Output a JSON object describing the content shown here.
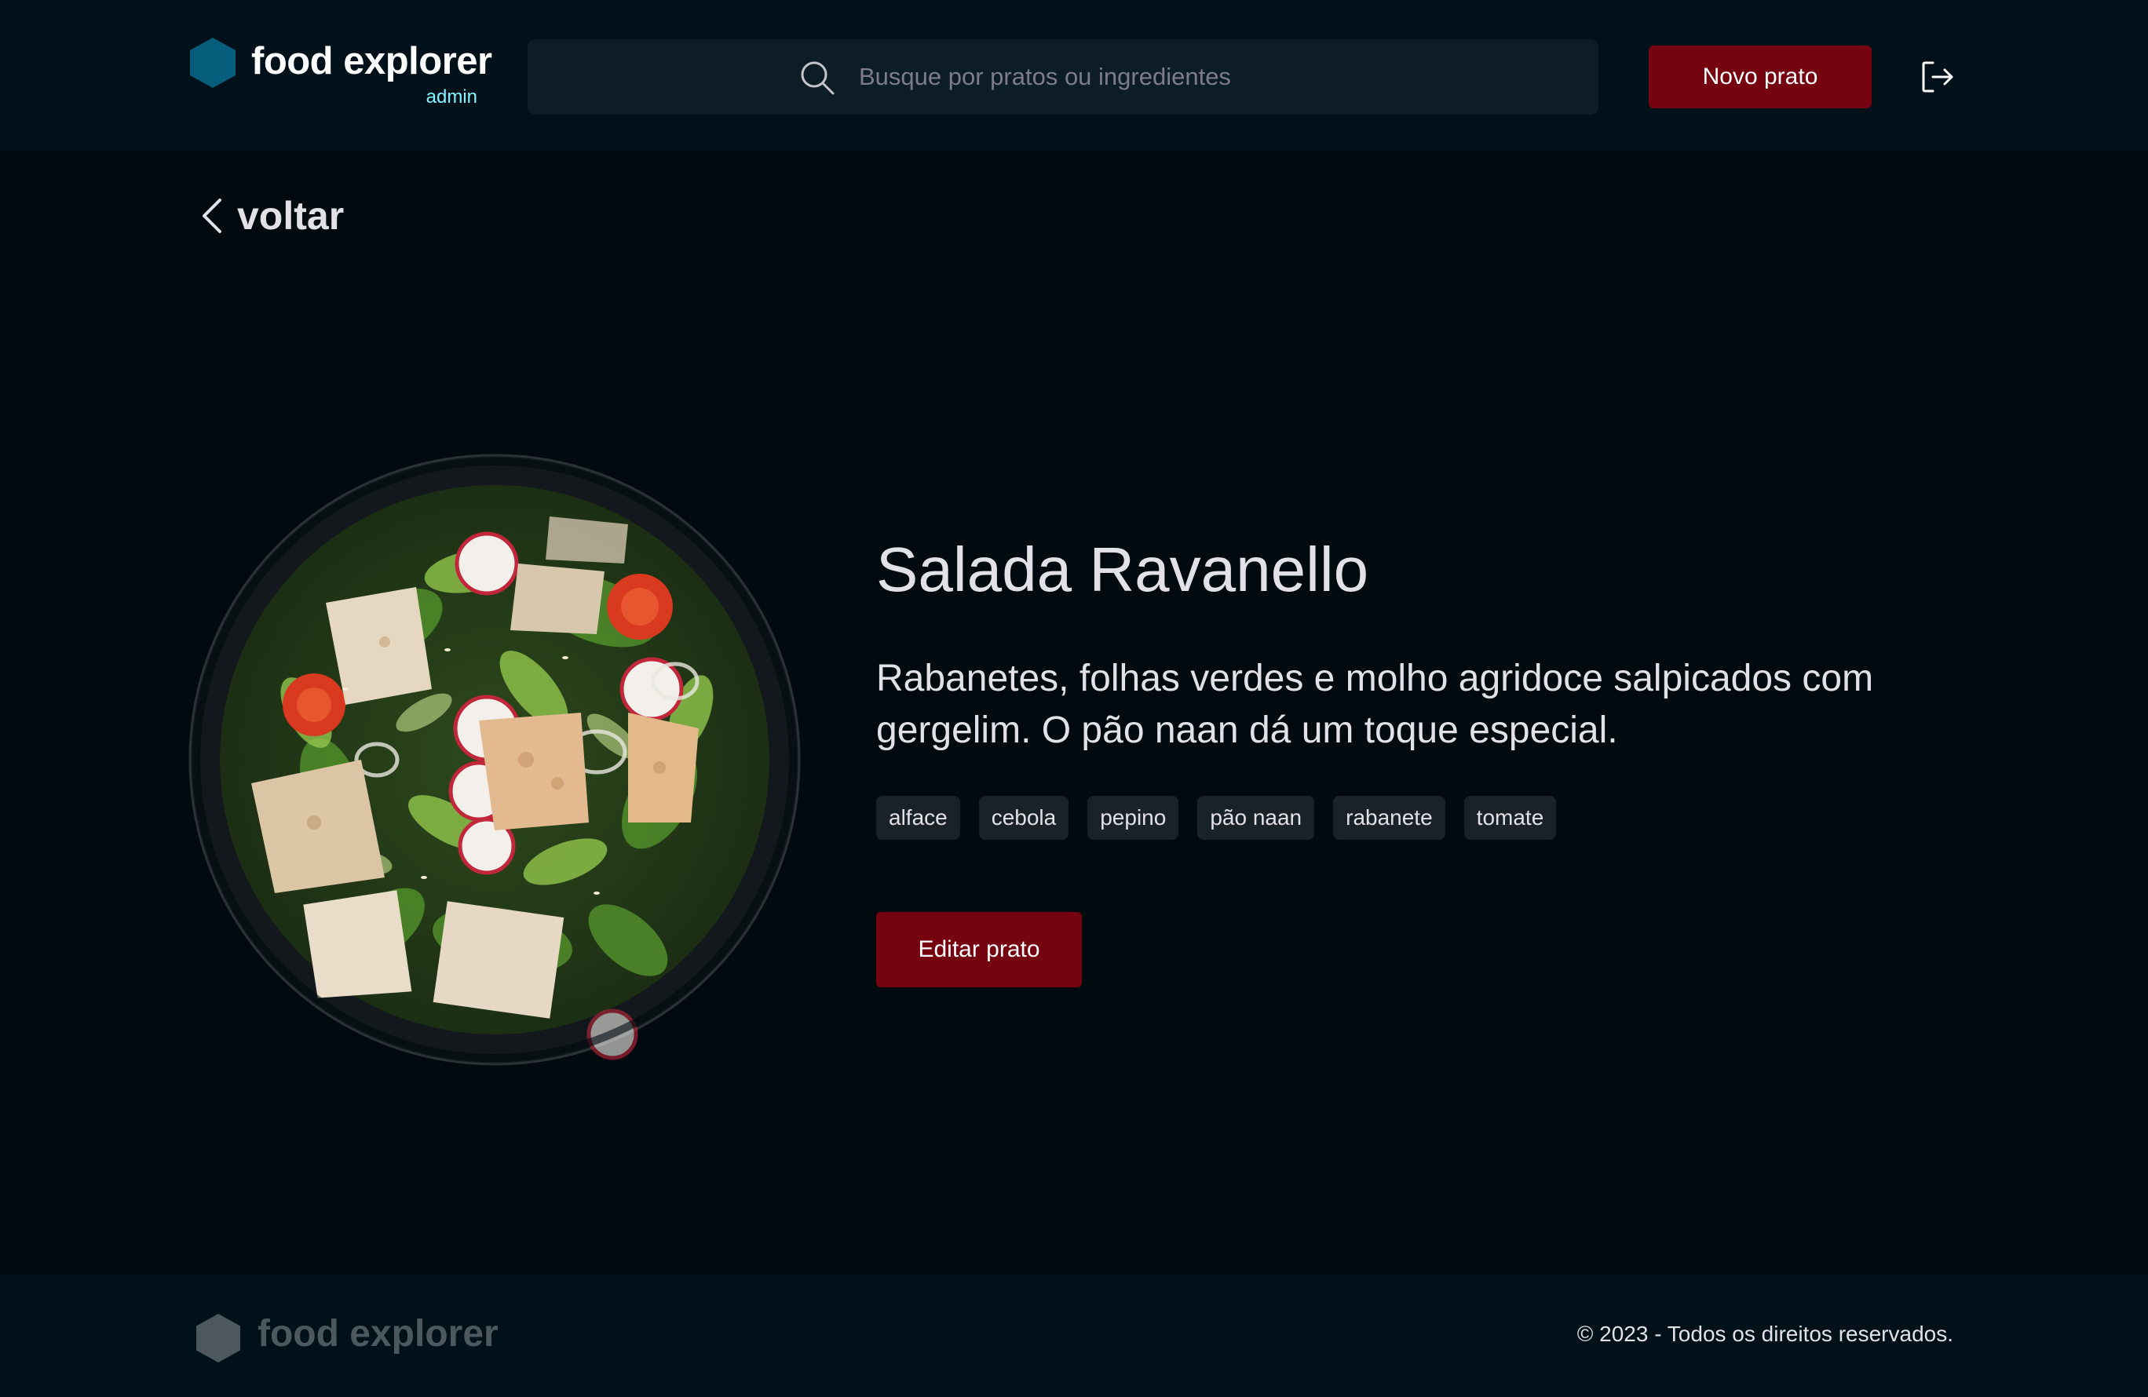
{
  "header": {
    "brand_name": "food explorer",
    "brand_role": "admin",
    "search_placeholder": "Busque por pratos ou ingredientes",
    "new_dish_label": "Novo prato"
  },
  "back_label": "voltar",
  "dish": {
    "name": "Salada Ravanello",
    "description": "Rabanetes, folhas verdes e molho agridoce salpicados com gergelim. O pão naan dá um toque especial.",
    "ingredients": [
      "alface",
      "cebola",
      "pepino",
      "pão naan",
      "rabanete",
      "tomate"
    ],
    "edit_label": "Editar prato"
  },
  "footer": {
    "brand_name": "food explorer",
    "copyright": "© 2023 - Todos os direitos reservados."
  },
  "colors": {
    "background": "#000a0f",
    "header_bg": "#00111a",
    "accent_red": "#750310",
    "brand_hex": "#065e7c",
    "admin_text": "#82f3ff",
    "tag_bg": "#192227"
  },
  "icons": {
    "brand": "hexagon-logo-icon",
    "search": "search-icon",
    "logout": "logout-icon",
    "back": "chevron-left-icon"
  }
}
